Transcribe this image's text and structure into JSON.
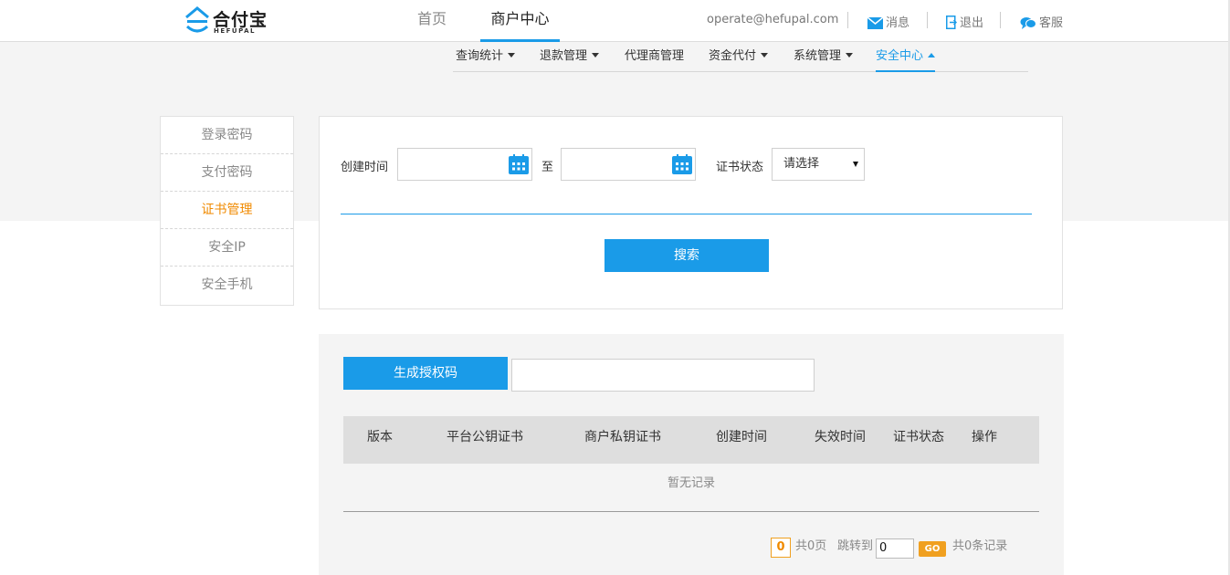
{
  "header": {
    "logo_text": "合付宝",
    "logo_sub": "HEFUPAL",
    "nav": {
      "home": "首页",
      "merchant_center": "商户中心"
    },
    "user_email": "operate@hefupal.com",
    "messages": "消息",
    "logout": "退出",
    "support": "客服"
  },
  "subnav": {
    "items": [
      "查询统计",
      "退款管理",
      "代理商管理",
      "资金代付",
      "系统管理",
      "安全中心"
    ]
  },
  "sidebar": {
    "items": [
      "登录密码",
      "支付密码",
      "证书管理",
      "安全IP",
      "安全手机"
    ],
    "active_index": 2
  },
  "search": {
    "create_time_label": "创建时间",
    "to_label": "至",
    "start_date": "",
    "end_date": "",
    "cert_status_label": "证书状态",
    "cert_status_value": "请选择",
    "search_button": "搜索"
  },
  "results": {
    "generate_button": "生成授权码",
    "auth_code_value": "",
    "columns": [
      "版本",
      "平台公钥证书",
      "商户私钥证书",
      "创建时间",
      "失效时间",
      "证书状态",
      "操作"
    ],
    "rows": [],
    "empty_text": "暂无记录"
  },
  "pagination": {
    "current_page": "0",
    "total_pages_text": "共0页",
    "jump_label": "跳转到",
    "jump_value": "0",
    "go_label": "GO",
    "total_records_text": "共0条记录"
  },
  "colors": {
    "accent": "#1a9be8",
    "active_side": "#f08a00"
  }
}
